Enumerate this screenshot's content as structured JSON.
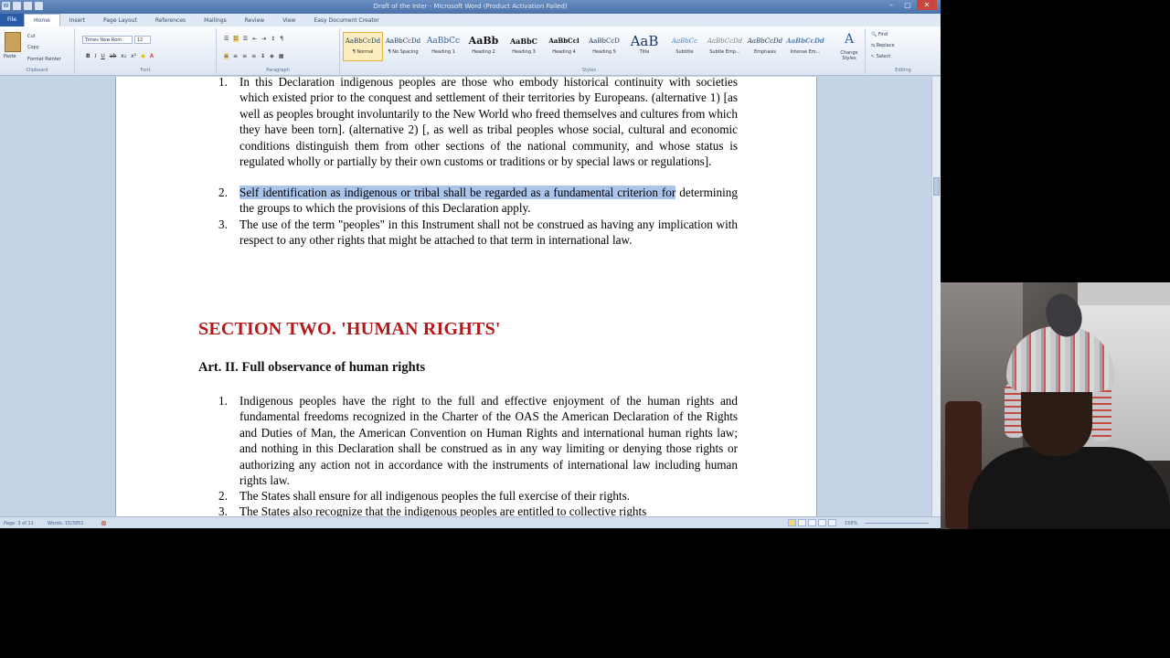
{
  "window": {
    "title": "Draft of the Inter - Microsoft Word (Product Activation Failed)",
    "min": "–",
    "max": "▢",
    "close": "✕"
  },
  "tabs": [
    "File",
    "Home",
    "Insert",
    "Page Layout",
    "References",
    "Mailings",
    "Review",
    "View",
    "Easy Document Creator"
  ],
  "ribbon": {
    "clipboard": {
      "paste": "Paste",
      "cut": "Cut",
      "copy": "Copy",
      "format_painter": "Format Painter",
      "label": "Clipboard"
    },
    "font": {
      "name": "Times New Rom",
      "size": "12",
      "label": "Font"
    },
    "paragraph": {
      "label": "Paragraph"
    },
    "styles": {
      "label": "Styles",
      "items": [
        {
          "preview": "AaBbCcDd",
          "name": "¶ Normal"
        },
        {
          "preview": "AaBbCcDd",
          "name": "¶ No Spacing"
        },
        {
          "preview": "AaBbCc",
          "name": "Heading 1"
        },
        {
          "preview": "AaBb",
          "name": "Heading 2"
        },
        {
          "preview": "AaBbC",
          "name": "Heading 3"
        },
        {
          "preview": "AaBbCcl",
          "name": "Heading 4"
        },
        {
          "preview": "AaBbCcD",
          "name": "Heading 5"
        },
        {
          "preview": "AaB",
          "name": "Title"
        },
        {
          "preview": "AaBbCc",
          "name": "Subtitle"
        },
        {
          "preview": "AaBbCcDd",
          "name": "Subtle Emp..."
        },
        {
          "preview": "AaBbCcDd",
          "name": "Emphasis"
        },
        {
          "preview": "AaBbCcDd",
          "name": "Intense Em..."
        }
      ],
      "change": "Change Styles"
    },
    "editing": {
      "find": "Find",
      "replace": "Replace",
      "select": "Select",
      "label": "Editing"
    }
  },
  "document": {
    "list1": [
      {
        "num": "1.",
        "text": "In this Declaration indigenous peoples are those who embody historical continuity with societies which existed prior to the conquest and settlement of their territories by Europeans. (alternative 1) [as well as peoples brought involuntarily to the New World who freed themselves and cultures from which they have been torn]. (alternative 2) [, as well as tribal peoples whose social, cultural and economic conditions distinguish them from other sections of the national community, and whose status is regulated wholly or partially by their own customs or traditions or by special laws or regulations]."
      },
      {
        "num": "2.",
        "highlighted": "Self identification as indigenous or tribal shall be regarded as a fundamental criterion for",
        "text": "determining the groups to which the provisions of this Declaration apply."
      },
      {
        "num": "3.",
        "text": "The use of the term \"peoples\" in this Instrument shall not be construed as having any implication with respect to any other rights that might be attached to that term in international law."
      }
    ],
    "section_heading": "SECTION TWO. 'HUMAN RIGHTS'",
    "article_heading": "Art. II. Full observance of human rights",
    "list2": [
      {
        "num": "1.",
        "text": "Indigenous peoples have the right to the full and effective enjoyment of the human rights and fundamental freedoms recognized in the Charter of the OAS the American Declaration of the Rights and Duties of Man, the American Convention on Human Rights and international human rights law; and nothing in this Declaration shall be construed as in any way limiting or denying those rights or authorizing any action not in accordance with the instruments of international law including human rights law."
      },
      {
        "num": "2.",
        "text": "The States shall ensure for all indigenous peoples the full exercise of their rights."
      },
      {
        "num": "3.",
        "text": "The States also recognize that the indigenous peoples are entitled to collective rights"
      }
    ]
  },
  "status": {
    "page": "Page: 3 of 11",
    "words": "Words: 15/3851",
    "zoom": "150%"
  },
  "colors": {
    "section_heading": "#b4191a",
    "selection": "#aac4ea",
    "titlebar": "#4a72ab"
  }
}
